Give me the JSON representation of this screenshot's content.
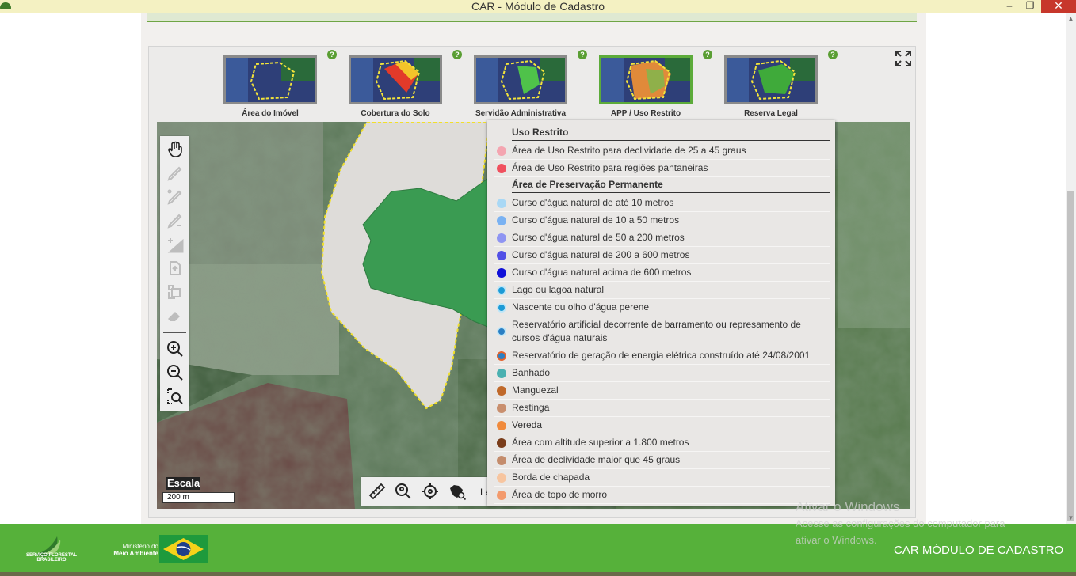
{
  "window": {
    "title": "CAR - Módulo de Cadastro",
    "minimize": "–",
    "maximize": "❐",
    "close": "✕"
  },
  "steps": [
    {
      "label": "Área do Imóvel",
      "active": false
    },
    {
      "label": "Cobertura do Solo",
      "active": false
    },
    {
      "label": "Servidão Administrativa",
      "active": false
    },
    {
      "label": "APP / Uso Restrito",
      "active": true
    },
    {
      "label": "Reserva Legal",
      "active": false
    }
  ],
  "help_glyph": "?",
  "toolbar_icons": [
    "hand-pan-icon",
    "draw-polygon-icon",
    "edit-vertices-icon",
    "cut-polygon-icon",
    "add-area-icon",
    "import-shape-icon",
    "move-polygon-icon",
    "eraser-icon",
    "zoom-in-icon",
    "zoom-out-icon",
    "zoom-extent-icon"
  ],
  "scale": {
    "title": "Escala",
    "value": "200 m"
  },
  "bottom_tools": {
    "icons": [
      "ruler-icon",
      "search-location-icon",
      "crosshair-icon",
      "brazil-map-search-icon"
    ],
    "cut_text": "Le"
  },
  "legend": {
    "sections": [
      {
        "title": "Uso Restrito",
        "items": [
          {
            "label": "Área de Uso Restrito para declividade de 25 a 45 graus",
            "color": "#f4a5b0"
          },
          {
            "label": "Área de Uso Restrito para regiões pantaneiras",
            "color": "#f0505e"
          }
        ]
      },
      {
        "title": "Área de Preservação Permanente",
        "items": [
          {
            "label": "Curso d'água natural de até 10 metros",
            "color": "#a9d8f5"
          },
          {
            "label": "Curso d'água natural de 10 a 50 metros",
            "color": "#7ab2f2"
          },
          {
            "label": "Curso d'água natural de 50 a 200 metros",
            "color": "#8f95f2"
          },
          {
            "label": "Curso d'água natural de 200 a 600 metros",
            "color": "#5250e6"
          },
          {
            "label": "Curso d'água natural acima de 600 metros",
            "color": "#1010d8"
          },
          {
            "label": "Lago ou lagoa natural",
            "color": "#1d9bd6",
            "ring": "#bfe6f7"
          },
          {
            "label": "Nascente ou olho d'água perene",
            "color": "#1d9bd6",
            "ring": "#bfe6f7"
          },
          {
            "label": "Reservatório artificial decorrente de barramento ou represamento de cursos d'água naturais",
            "color": "#2a7fc4",
            "ring": "#bfe6f7"
          },
          {
            "label": "Reservatório de geração de energia elétrica construído até 24/08/2001",
            "color": "#2a7fc4",
            "ring": "#e4622c"
          },
          {
            "label": "Banhado",
            "color": "#4ab0b0"
          },
          {
            "label": "Manguezal",
            "color": "#c0692a"
          },
          {
            "label": "Restinga",
            "color": "#c98f6e"
          },
          {
            "label": "Vereda",
            "color": "#f08a3c"
          },
          {
            "label": "Área com altitude superior a 1.800 metros",
            "color": "#7a3d1a"
          },
          {
            "label": "Área de declividade maior que 45 graus",
            "color": "#c48c6c"
          },
          {
            "label": "Borda de chapada",
            "color": "#f7c59f"
          },
          {
            "label": "Área de topo de morro",
            "color": "#f39a6c"
          }
        ]
      }
    ]
  },
  "footer": {
    "sfb_line1": "SERVIÇO FLORESTAL",
    "sfb_line2": "BRASILEIRO",
    "mma_line1": "Ministério do",
    "mma_line2": "Meio Ambiente",
    "title": "CAR  MÓDULO DE CADASTRO"
  },
  "watermark": {
    "line1": "Ativar o Windows",
    "line2": "Acesse as configurações do computador para",
    "line3": "ativar o Windows."
  }
}
